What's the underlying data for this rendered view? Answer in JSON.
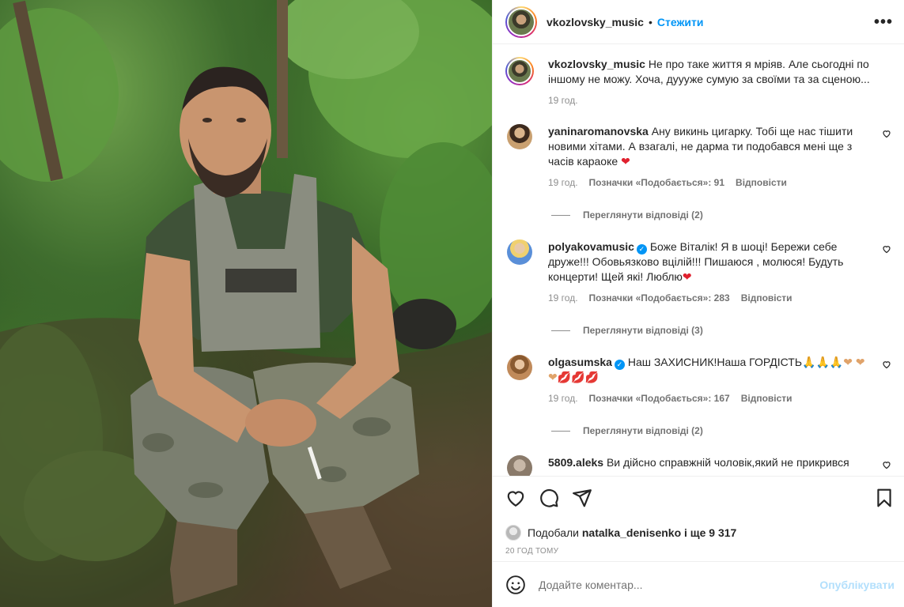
{
  "post": {
    "author": "vkozlovsky_music",
    "separator": "•",
    "follow_label": "Стежити",
    "more_label": "•••",
    "caption_text": "Не про таке життя я мріяв. Але сьогодні по іншому не можу. Хоча, дуууже сумую за своїми та за сценою...",
    "caption_time": "19 год."
  },
  "comments": [
    {
      "user": "yaninaromanovska",
      "verified": false,
      "text": "Ану викинь цигарку. Тобі ще нас тішити новими хітами. А взагалі, не дарма ти подобався мені ще з часів караоке",
      "emoji": "❤",
      "time": "19 год.",
      "likes": "Позначки «Подобається»: 91",
      "reply": "Відповісти",
      "view_replies": "Переглянути відповіді (2)"
    },
    {
      "user": "polyakovamusic",
      "verified": true,
      "text": "Боже Віталік! Я в шоці! Бережи себе друже!!! Обовьязково вцілій!!! Пишаюся , молюся! Будуть концерти! Щей які! Люблю",
      "emoji": "❤",
      "time": "19 год.",
      "likes": "Позначки «Подобається»: 283",
      "reply": "Відповісти",
      "view_replies": "Переглянути відповіді (3)"
    },
    {
      "user": "olgasumska",
      "verified": true,
      "text": "Наш ЗАХИСНИК!Наша ГОРДІСТЬ",
      "emoji": "🙏🙏🙏❤ ❤❤💋💋💋",
      "time": "19 год.",
      "likes": "Позначки «Подобається»: 167",
      "reply": "Відповісти",
      "view_replies": "Переглянути відповіді (2)"
    },
    {
      "user": "5809.aleks",
      "verified": false,
      "text": "Ви дійсно справжній чоловік,який не прикрився"
    }
  ],
  "likes_bar": {
    "prefix": "Подобали",
    "user": "natalka_denisenko",
    "suffix": "і ще 9 317"
  },
  "post_age": "20 ГОД ТОМУ",
  "comment_box": {
    "placeholder": "Додайте коментар...",
    "publish_label": "Опублікувати"
  },
  "icons": {
    "like": "heart-icon",
    "comment": "comment-icon",
    "share": "share-icon",
    "save": "bookmark-icon",
    "emoji": "emoji-icon"
  },
  "colors": {
    "link_blue": "#0095f6",
    "publish_disabled": "#b2dffc",
    "muted": "#8e8e8e",
    "verified": "#0095f6"
  }
}
